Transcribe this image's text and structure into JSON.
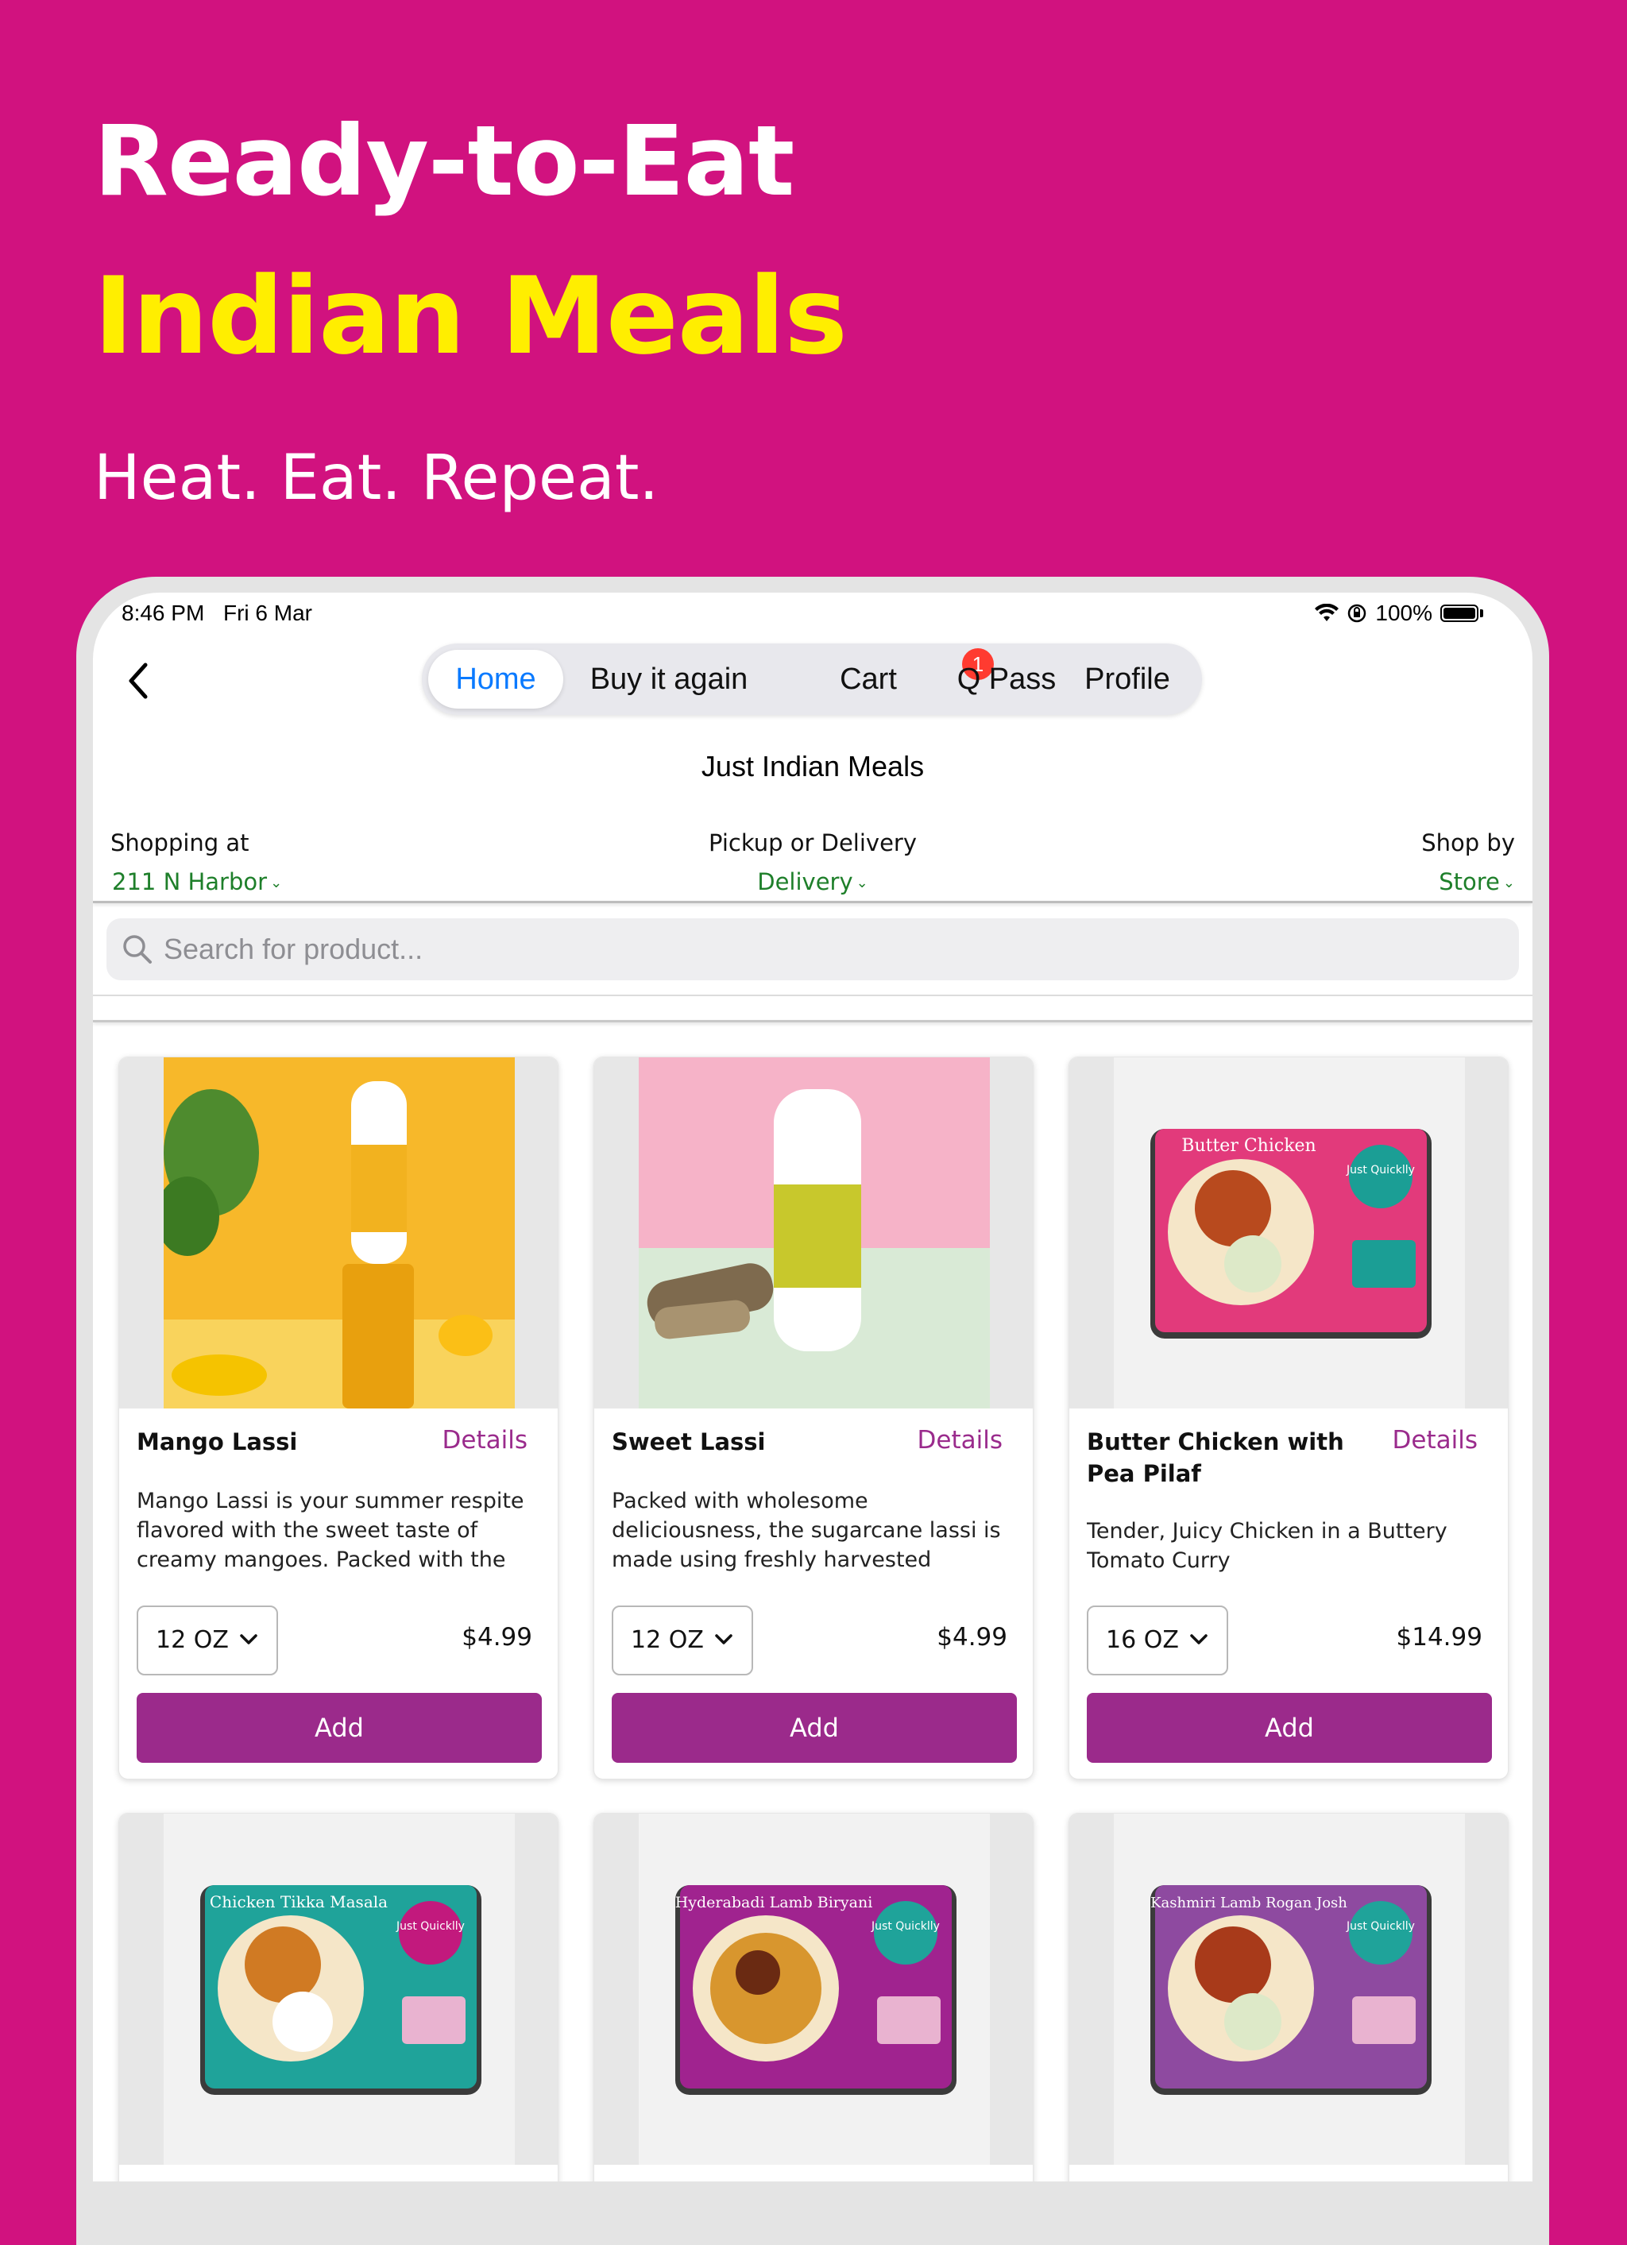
{
  "hero": {
    "line1": "Ready-to-Eat",
    "line2": "Indian Meals",
    "line3": "Heat. Eat. Repeat."
  },
  "status_bar": {
    "time": "8:46 PM",
    "date": "Fri 6 Mar",
    "battery": "100%"
  },
  "tabs": [
    {
      "label": "Home",
      "active": true
    },
    {
      "label": "Buy it again",
      "active": false
    },
    {
      "label": "Cart",
      "active": false,
      "badge": "1"
    },
    {
      "label": "Q Pass",
      "active": false
    },
    {
      "label": "Profile",
      "active": false
    }
  ],
  "store_title": "Just Indian Meals",
  "location_bar": {
    "shopping_at_label": "Shopping at",
    "shopping_at_value": "211 N Harbor",
    "fulfillment_label": "Pickup or Delivery",
    "fulfillment_value": "Delivery",
    "shop_by_label": "Shop by",
    "shop_by_value": "Store"
  },
  "search": {
    "placeholder": "Search for product..."
  },
  "colors": {
    "background": "#D1127F",
    "hero_highlight": "#FFEE00",
    "active_tab": "#0A7AFF",
    "location_value": "#1E7F2A",
    "accent_purple": "#9B2A8B",
    "badge": "#FF3B30"
  },
  "products": [
    {
      "name": "Mango Lassi",
      "details_label": "Details",
      "description": "Mango Lassi is your summer respite flavored with the sweet taste of creamy mangoes. Packed with the s…",
      "size": "12 OZ",
      "price": "$4.99",
      "add_label": "Add",
      "image": "mango-lassi-bottle"
    },
    {
      "name": "Sweet Lassi",
      "details_label": "Details",
      "description": "Packed with wholesome deliciousness, the sugarcane lassi is made using freshly harvested sugar…",
      "size": "12 OZ",
      "price": "$4.99",
      "add_label": "Add",
      "image": "sweet-lassi-bottle"
    },
    {
      "name": "Butter Chicken with Pea Pilaf",
      "details_label": "Details",
      "description": "Tender, Juicy Chicken in a Buttery Tomato Curry",
      "size": "16 OZ",
      "price": "$14.99",
      "add_label": "Add",
      "image": "butter-chicken-tray"
    },
    {
      "name": "",
      "image": "chicken-tikka-masala-tray",
      "package_label": "Chicken Tikka Masala",
      "brand": "Just Quicklly"
    },
    {
      "name": "",
      "image": "hyderabadi-lamb-biryani-tray",
      "package_label": "Hyderabadi Lamb Biryani",
      "brand": "Just Quicklly"
    },
    {
      "name": "",
      "image": "kashmiri-lamb-rogan-josh-tray",
      "package_label": "Kashmiri Lamb Rogan Josh",
      "brand": "Just Quicklly"
    }
  ],
  "butter_chicken_package": {
    "label": "Butter Chicken",
    "brand": "Just Quicklly"
  }
}
